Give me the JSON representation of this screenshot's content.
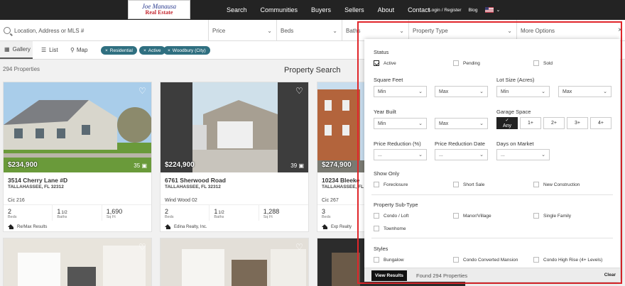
{
  "logo": {
    "line1": "Joe Manausa",
    "line2": "Real Estate"
  },
  "nav": {
    "items": [
      "Search",
      "Communities",
      "Buyers",
      "Sellers",
      "About",
      "Contact"
    ],
    "login": "Login / Register",
    "blog": "Blog"
  },
  "filters": {
    "search_placeholder": "Location, Address or MLS #",
    "price": "Price",
    "beds": "Beds",
    "baths": "Baths",
    "property_type": "Property Type",
    "more_options": "More Options",
    "close": "×"
  },
  "views": {
    "gallery": "Gallery",
    "list": "List",
    "map": "Map"
  },
  "chips": [
    "Residential",
    "Active",
    "Woodbury (City)"
  ],
  "results": {
    "count": "294 Properties",
    "title": "Property Search"
  },
  "cards": [
    {
      "price": "$234,900",
      "photos": "35",
      "address": "3514 Cherry Lane #D",
      "city": "TALLAHASSEE, FL 32312",
      "subdivision": "Cic 216",
      "beds": "2",
      "beds_label": "Beds",
      "baths_full": "1",
      "baths_frac": "1/2",
      "baths_label": "Baths",
      "sqft": "1,690",
      "sqft_label": "Sq Ft",
      "broker": "Re/Max Results"
    },
    {
      "price": "$224,900",
      "photos": "39",
      "address": "6761 Sherwood Road",
      "city": "TALLAHASSEE, FL 32312",
      "subdivision": "Wind Wood 02",
      "beds": "2",
      "beds_label": "Beds",
      "baths_full": "1",
      "baths_frac": "1/2",
      "baths_label": "Baths",
      "sqft": "1,288",
      "sqft_label": "Sq Ft",
      "broker": "Edina Realty, Inc."
    },
    {
      "price": "$274,900",
      "photos": "",
      "address": "10234 Bleeke",
      "city": "TALLAHASSEE, FL",
      "subdivision": "Cic 267",
      "beds": "3",
      "beds_label": "Beds",
      "baths_full": "",
      "baths_frac": "",
      "baths_label": "",
      "sqft": "",
      "sqft_label": "",
      "broker": "Exp Realty"
    }
  ],
  "panel": {
    "status": {
      "title": "Status",
      "options": [
        "Active",
        "Pending",
        "Sold"
      ]
    },
    "sqft": {
      "title": "Square Feet",
      "min": "Min",
      "max": "Max"
    },
    "lot": {
      "title": "Lot Size (Acres)",
      "min": "Min",
      "max": "Max"
    },
    "year": {
      "title": "Year Built",
      "min": "Min",
      "max": "Max"
    },
    "garage": {
      "title": "Garage Space",
      "any": "Any",
      "options": [
        "1+",
        "2+",
        "3+",
        "4+"
      ]
    },
    "price_reduction_pct": {
      "title": "Price Reduction (%)",
      "value": "..."
    },
    "price_reduction_date": {
      "title": "Price Reduction Date",
      "value": "..."
    },
    "dom": {
      "title": "Days on Market",
      "value": "..."
    },
    "show_only": {
      "title": "Show Only",
      "options": [
        "Foreclosure",
        "Short Sale",
        "New Construction"
      ]
    },
    "subtype": {
      "title": "Property Sub-Type",
      "options": [
        "Condo / Loft",
        "Manor/Village",
        "Single Family",
        "Townhome"
      ]
    },
    "styles": {
      "title": "Styles",
      "options": [
        "Bungalow",
        "Condo Converted Mansion",
        "Condo High Rise (4+ Levels)"
      ]
    },
    "footer": {
      "view_results": "View Results",
      "found": "Found 294 Properties",
      "clear": "Clear"
    }
  }
}
